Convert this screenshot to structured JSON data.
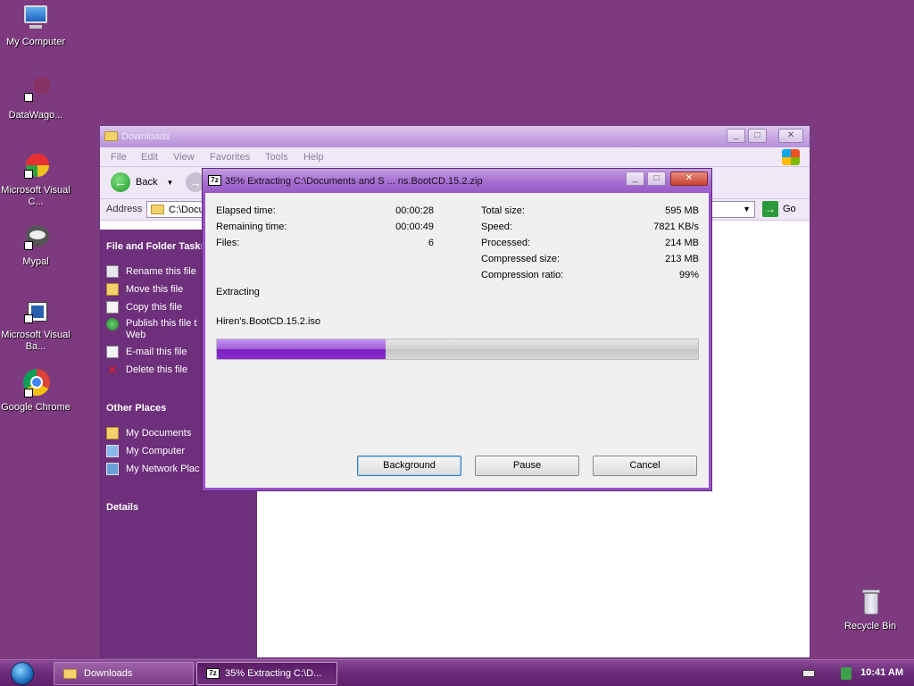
{
  "desktop": {
    "icons": [
      {
        "label": "My Computer",
        "icon": "computer-icon"
      },
      {
        "label": "DataWago...",
        "icon": "shortcut-icon"
      },
      {
        "label": "Microsoft Visual C...",
        "icon": "visual-c-icon"
      },
      {
        "label": "Mypal",
        "icon": "mypal-icon"
      },
      {
        "label": "Microsoft Visual Ba...",
        "icon": "visual-basic-icon"
      },
      {
        "label": "Google Chrome",
        "icon": "chrome-icon"
      },
      {
        "label": "Recycle Bin",
        "icon": "recycle-bin-icon"
      }
    ]
  },
  "explorer": {
    "title": "Downloads",
    "menu": [
      "File",
      "Edit",
      "View",
      "Favorites",
      "Tools",
      "Help"
    ],
    "toolbar": {
      "back_label": "Back"
    },
    "address": {
      "label": "Address",
      "value": "C:\\Docu",
      "go_label": "Go"
    },
    "sidebar": {
      "tasks_header": "File and Folder Tasks",
      "tasks": [
        {
          "label": "Rename this file"
        },
        {
          "label": "Move this file"
        },
        {
          "label": "Copy this file"
        },
        {
          "label": "Publish this file t",
          "label2": "Web"
        },
        {
          "label": "E-mail this file"
        },
        {
          "label": "Delete this file"
        }
      ],
      "places_header": "Other Places",
      "places": [
        {
          "label": "My Documents"
        },
        {
          "label": "My Computer"
        },
        {
          "label": "My Network Plac"
        }
      ],
      "details_header": "Details"
    }
  },
  "dialog": {
    "title": "35% Extracting C:\\Documents and S ... ns.BootCD.15.2.zip",
    "left_stats": [
      {
        "label": "Elapsed time:",
        "value": "00:00:28"
      },
      {
        "label": "Remaining time:",
        "value": "00:00:49"
      },
      {
        "label": "Files:",
        "value": "6"
      }
    ],
    "right_stats": [
      {
        "label": "Total size:",
        "value": "595 MB"
      },
      {
        "label": "Speed:",
        "value": "7821 KB/s"
      },
      {
        "label": "Processed:",
        "value": "214 MB"
      },
      {
        "label": "Compressed size:",
        "value": "213 MB"
      },
      {
        "label": "Compression ratio:",
        "value": "99%"
      }
    ],
    "status": "Extracting",
    "current_file": "Hiren's.BootCD.15.2.iso",
    "progress_percent": 35,
    "buttons": {
      "background": "Background",
      "pause": "Pause",
      "cancel": "Cancel"
    }
  },
  "taskbar": {
    "tasks": [
      {
        "label": "Downloads"
      },
      {
        "label": "35% Extracting C:\\D..."
      }
    ],
    "time": "10:41 AM"
  }
}
